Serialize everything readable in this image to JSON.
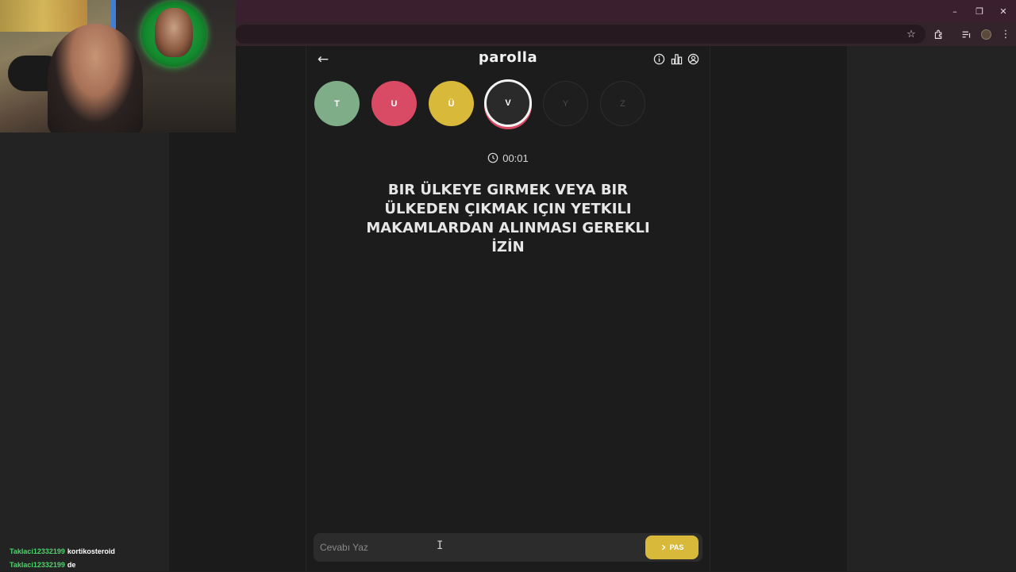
{
  "browser": {
    "window_controls": {
      "minimize": "–",
      "restore": "❐",
      "close": "✕"
    },
    "toolbar_icons": [
      "star-icon",
      "extensions-icon",
      "media-icon",
      "profile-icon",
      "menu-icon"
    ]
  },
  "game": {
    "brand": "parolla",
    "header_icons": [
      "info-icon",
      "stats-icon",
      "user-icon"
    ],
    "letters": [
      {
        "char": "T",
        "state": "correct",
        "color": "#7fad87"
      },
      {
        "char": "U",
        "state": "wrong",
        "color": "#d94a64"
      },
      {
        "char": "Ü",
        "state": "passed",
        "color": "#d8b93a"
      },
      {
        "char": "V",
        "state": "active"
      },
      {
        "char": "Y",
        "state": "pending"
      },
      {
        "char": "Z",
        "state": "pending"
      }
    ],
    "timer": "00:01",
    "question": "BIR ÜLKEYE GIRMEK VEYA BIR ÜLKEDEN ÇIKMAK IÇIN YETKILI MAKAMLARDAN ALINMASI GEREKLI İZİN",
    "answer": {
      "placeholder": "Cevabı Yaz",
      "value": ""
    },
    "pass_button": "PAS"
  },
  "chat": [
    {
      "user": "Taklaci12332199",
      "message": "kortikosteroid"
    },
    {
      "user": "Taklaci12332199",
      "message": "de"
    }
  ],
  "colors": {
    "correct": "#7fad87",
    "wrong": "#d94a64",
    "passed": "#d8b93a",
    "titlebar": "#3a1f2e"
  }
}
